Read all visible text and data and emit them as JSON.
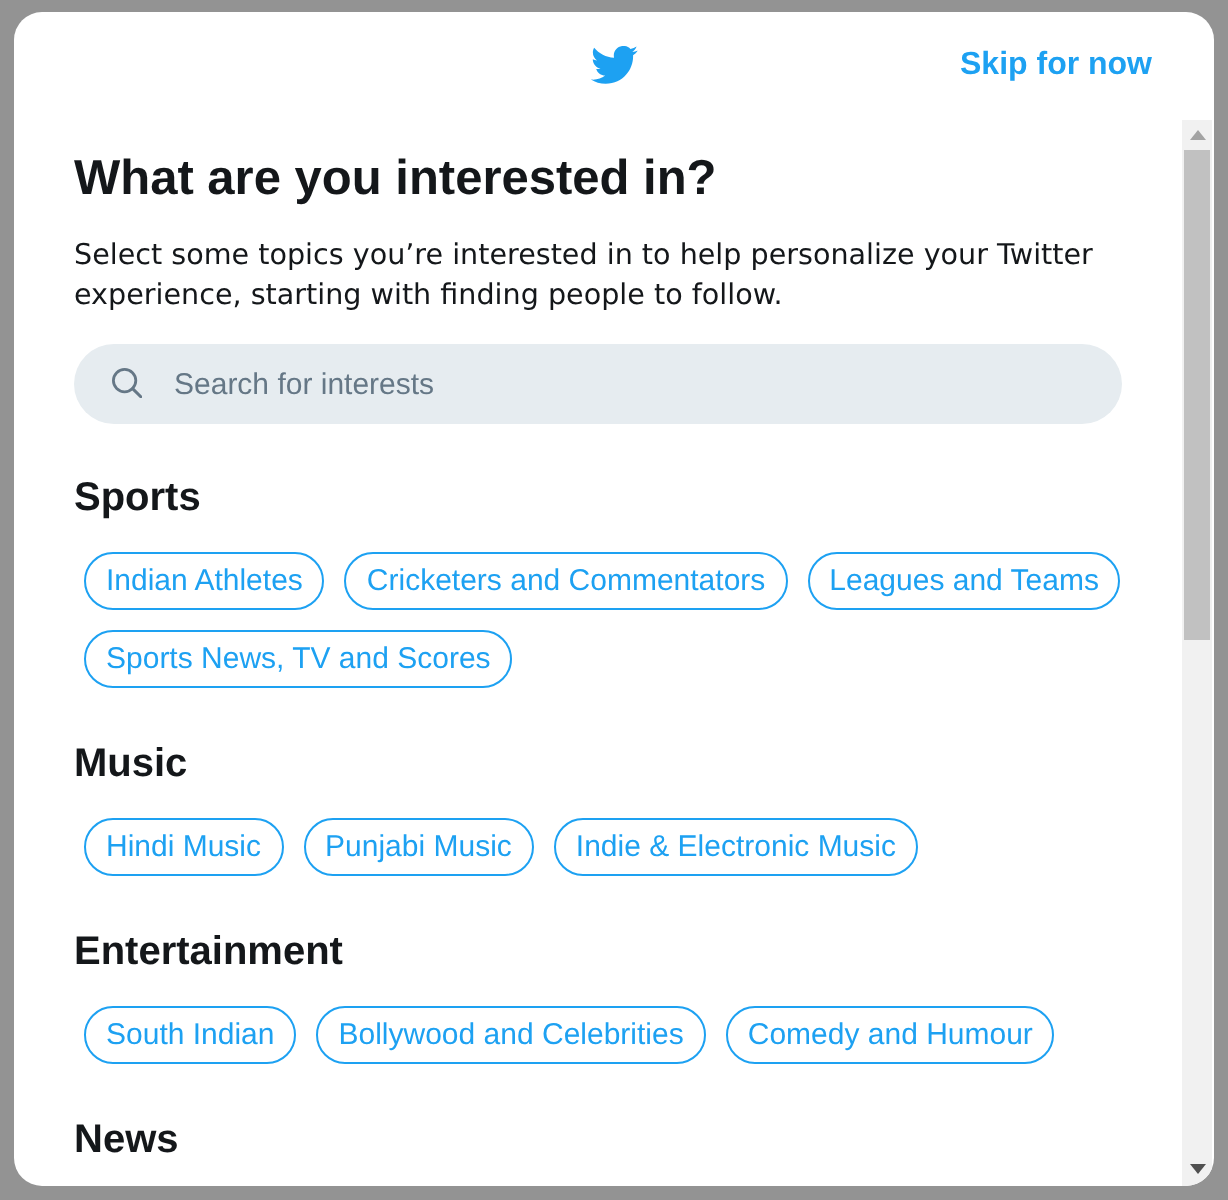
{
  "header": {
    "skip_link": "Skip for now"
  },
  "title": "What are you interested in?",
  "description": "Select some topics you’re interested in to help personalize your Twitter experience, starting with finding people to follow.",
  "search": {
    "placeholder": "Search for interests"
  },
  "categories": [
    {
      "name": "Sports",
      "topics": [
        {
          "label": "Indian Athletes",
          "selected": false
        },
        {
          "label": "Cricketers and Commentators",
          "selected": false
        },
        {
          "label": "Leagues and Teams",
          "selected": false
        },
        {
          "label": "Sports News, TV and Scores",
          "selected": false
        }
      ]
    },
    {
      "name": "Music",
      "topics": [
        {
          "label": "Hindi Music",
          "selected": false
        },
        {
          "label": "Punjabi Music",
          "selected": false
        },
        {
          "label": "Indie & Electronic Music",
          "selected": false
        }
      ]
    },
    {
      "name": "Entertainment",
      "topics": [
        {
          "label": "South Indian",
          "selected": false
        },
        {
          "label": "Bollywood and Celebrities",
          "selected": false
        },
        {
          "label": "Comedy and Humour",
          "selected": false
        }
      ]
    },
    {
      "name": "News"
    }
  ]
}
